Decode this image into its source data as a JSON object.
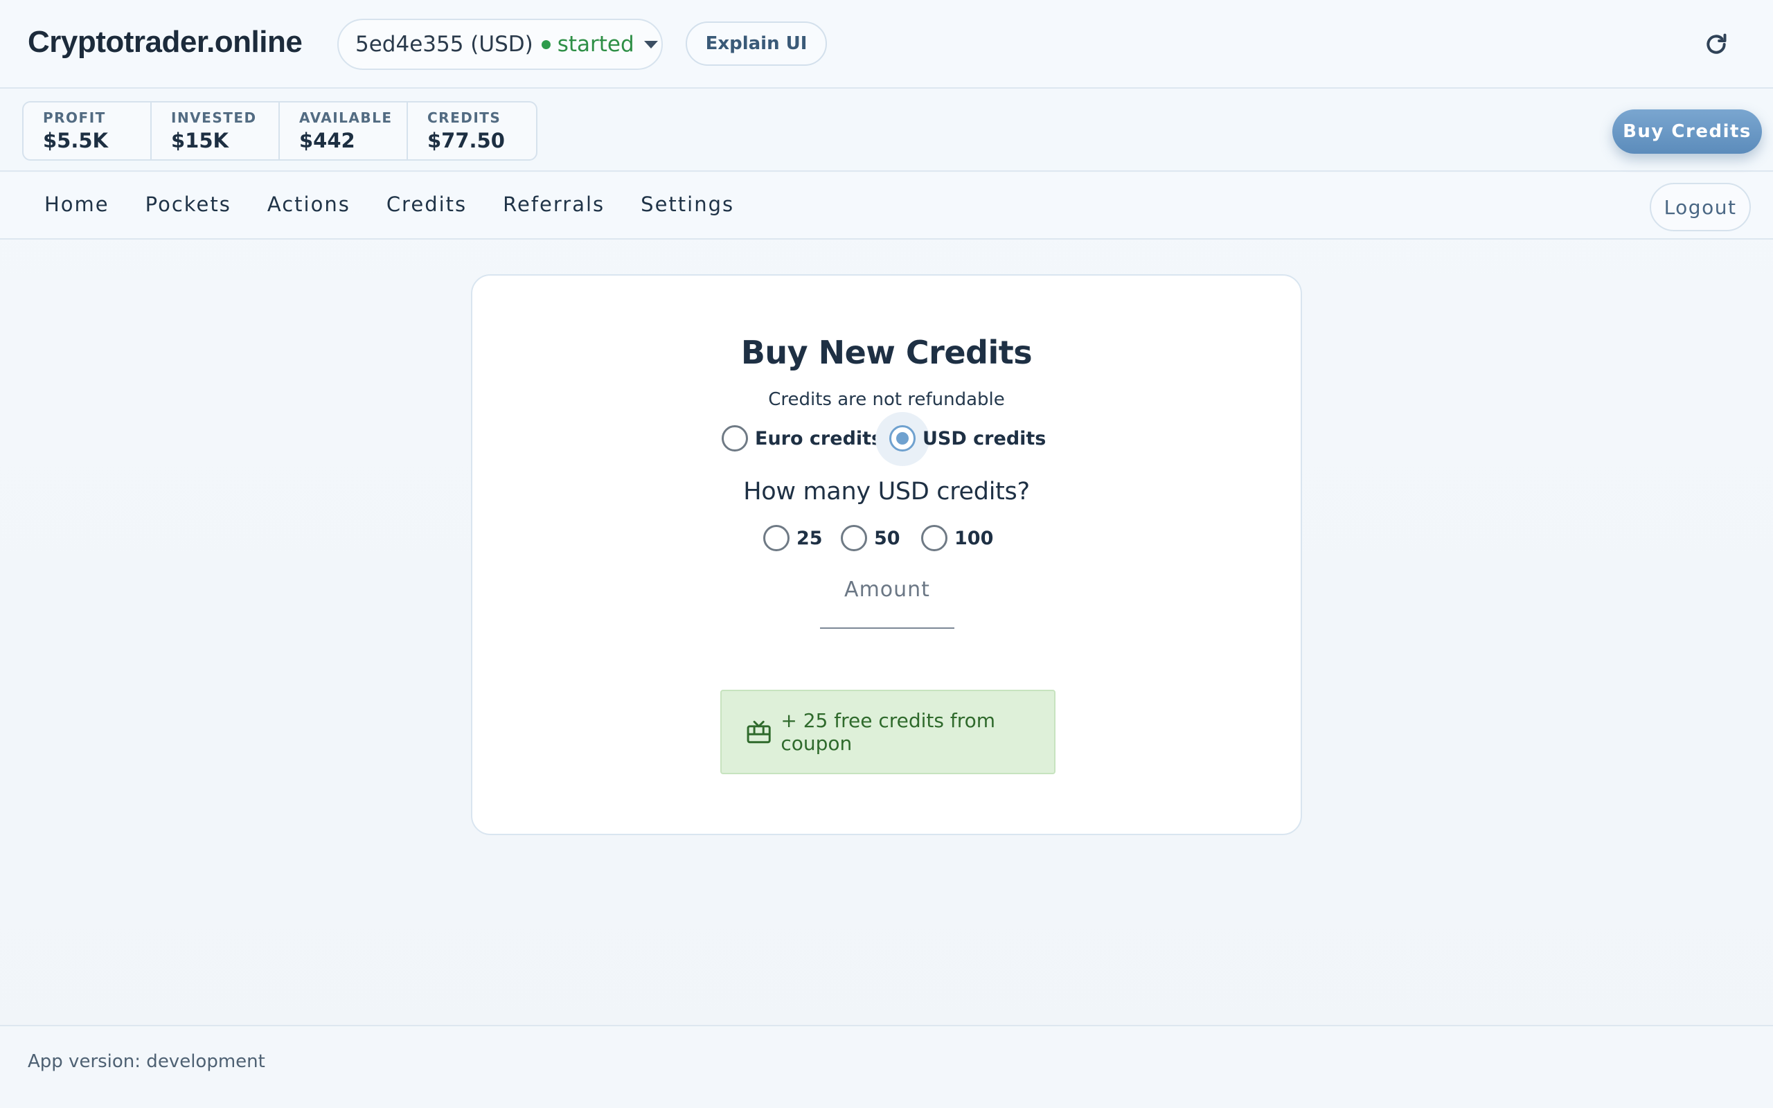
{
  "header": {
    "logo_text": "Cryptotrader.online",
    "pocket": {
      "id_label": "5ed4e355 (USD)",
      "status": "started"
    },
    "explain_label": "Explain UI",
    "refresh_icon": "refresh-icon"
  },
  "stats": [
    {
      "label": "PROFIT",
      "value": "$5.5K"
    },
    {
      "label": "INVESTED",
      "value": "$15K"
    },
    {
      "label": "AVAILABLE",
      "value": "$442"
    },
    {
      "label": "CREDITS",
      "value": "$77.50"
    }
  ],
  "buy_credits_label": "Buy Credits",
  "nav": {
    "items": [
      "Home",
      "Pockets",
      "Actions",
      "Credits",
      "Referrals",
      "Settings"
    ],
    "logout_label": "Logout"
  },
  "card": {
    "title": "Buy New Credits",
    "subtitle": "Credits are not refundable",
    "currency_options": [
      {
        "label": "Euro credits",
        "checked": false
      },
      {
        "label": "USD credits",
        "checked": true
      }
    ],
    "how_many": "How many USD credits?",
    "amount_options": [
      {
        "label": "25",
        "checked": false
      },
      {
        "label": "50",
        "checked": false
      },
      {
        "label": "100",
        "checked": false
      }
    ],
    "amount_placeholder": "Amount",
    "coupon_text": "+ 25 free credits from coupon",
    "coupon_icon": "gift-card-icon"
  },
  "footer": {
    "version_text": "App version: development"
  },
  "colors": {
    "accent": "#6fa1cf",
    "status_green": "#2e9b4b",
    "coupon_bg": "#def0d9",
    "coupon_text": "#2f6a2c"
  }
}
